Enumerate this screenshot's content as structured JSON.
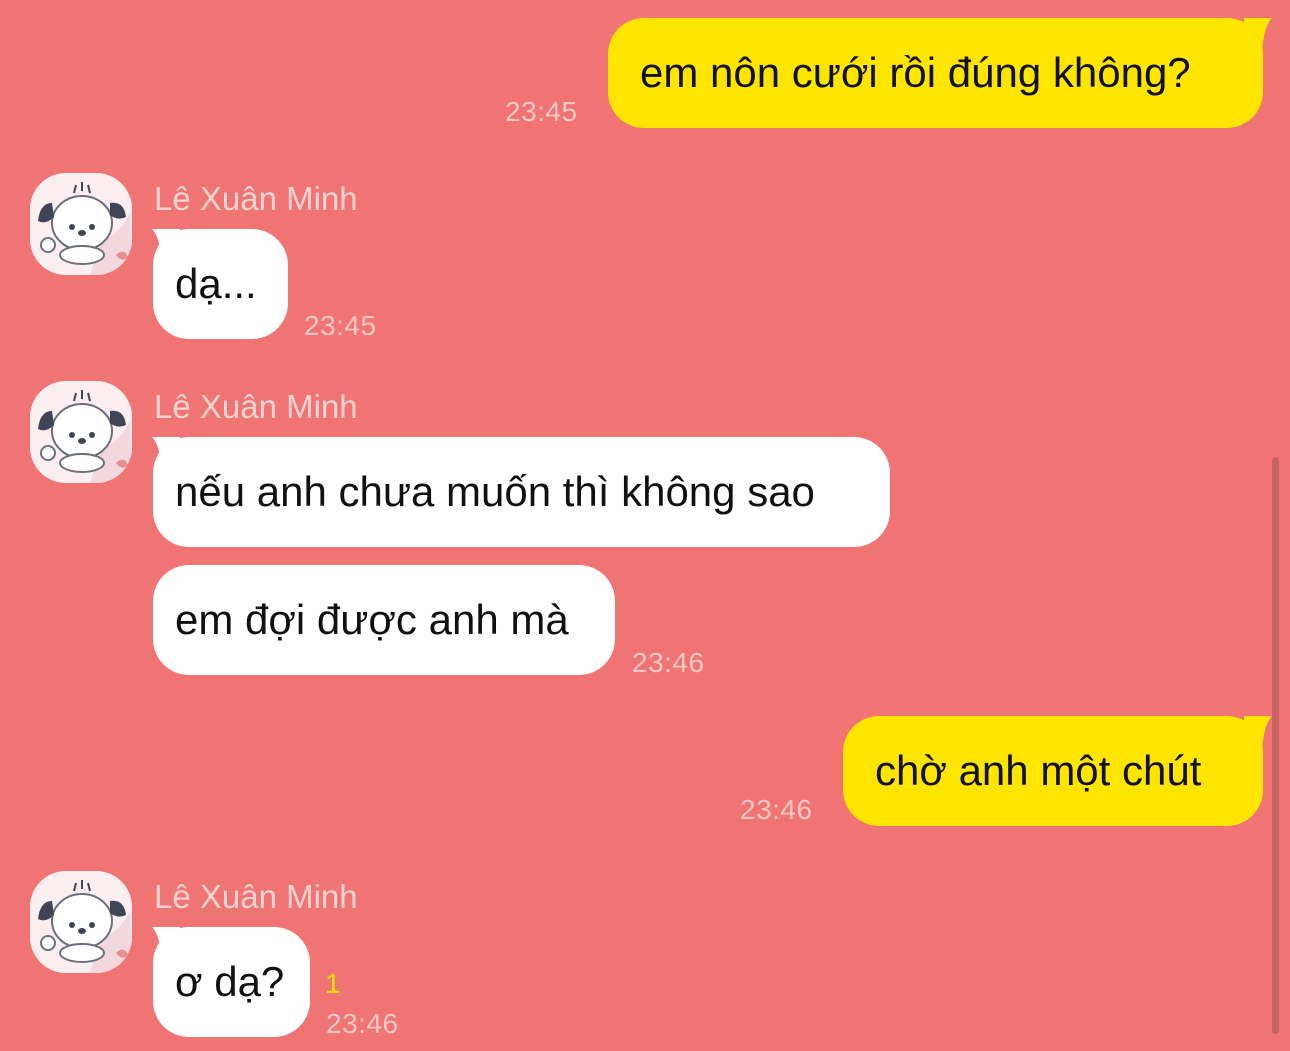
{
  "contact": {
    "name": "Lê Xuân Minh",
    "avatar_icon": "pochacco-avatar-icon"
  },
  "colors": {
    "background": "#f07474",
    "outgoing_bubble": "#fee500",
    "incoming_bubble": "#ffffff",
    "timestamp": "#f8c7c3",
    "unread_count": "#fee500"
  },
  "messages": [
    {
      "direction": "outgoing",
      "text": "em nôn cưới rồi đúng không?",
      "time": "23:45"
    },
    {
      "direction": "incoming",
      "sender": "Lê Xuân Minh",
      "text": "dạ...",
      "time": "23:45"
    },
    {
      "direction": "incoming",
      "sender": "Lê Xuân Minh",
      "text": "nếu anh chưa muốn thì không sao"
    },
    {
      "direction": "incoming",
      "text": "em đợi được anh mà",
      "time": "23:46"
    },
    {
      "direction": "outgoing",
      "text": "chờ anh một chút",
      "time": "23:46"
    },
    {
      "direction": "incoming",
      "sender": "Lê Xuân Minh",
      "text": "ơ dạ?",
      "time": "23:46",
      "unread": "1"
    }
  ]
}
